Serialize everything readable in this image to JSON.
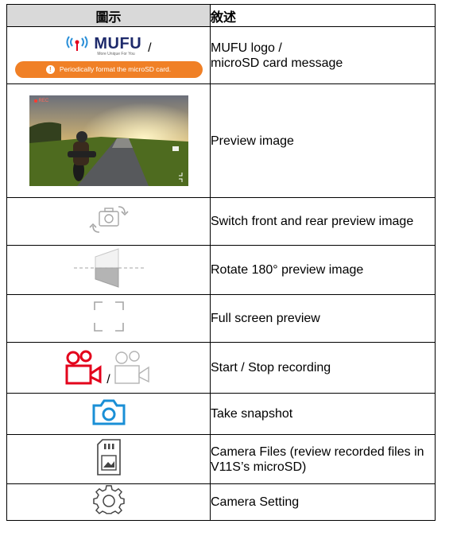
{
  "header": {
    "col_icon": "圖示",
    "col_desc": "敘述"
  },
  "rows": [
    {
      "icon": "mufu-logo-and-microsd-message-icon",
      "desc": "MUFU logo /\nmicroSD card message"
    },
    {
      "icon": "preview-image-thumbnail",
      "desc": "Preview image"
    },
    {
      "icon": "switch-camera-icon",
      "desc": "Switch front and rear preview image"
    },
    {
      "icon": "rotate-icon",
      "desc": "Rotate 180° preview image"
    },
    {
      "icon": "fullscreen-icon",
      "desc": "Full screen preview"
    },
    {
      "icon": "record-icon",
      "desc": "Start / Stop recording"
    },
    {
      "icon": "camera-icon",
      "desc": "Take snapshot"
    },
    {
      "icon": "sd-card-files-icon",
      "desc": "Camera Files (review recorded files in V11S’s microSD)"
    },
    {
      "icon": "gear-icon",
      "desc": "Camera Setting"
    }
  ],
  "mufu": {
    "brand": "MUFU",
    "tagline": "More Unique For You",
    "separator": "/"
  },
  "record_separator": "/",
  "microsd_message": "Periodically format the microSD card.",
  "preview_overlay": "REC",
  "colors": {
    "record_red": "#e3001b",
    "snapshot_blue": "#1a8fd6",
    "message_orange": "#f08026",
    "header_gray": "#d9d9d9"
  }
}
